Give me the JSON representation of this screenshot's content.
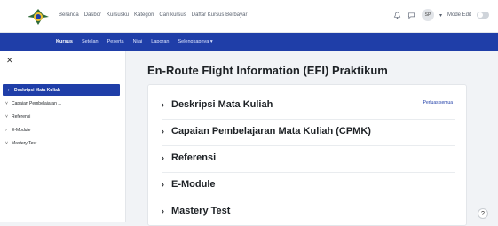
{
  "top_nav": [
    "Beranda",
    "Dasbor",
    "Kursusku",
    "Kategori",
    "Cari kursus",
    "Daftar Kursus Berbayar"
  ],
  "user": {
    "initials": "SP",
    "edit_mode_label": "Mode Edit"
  },
  "course_nav": [
    "Kursus",
    "Setelan",
    "Peserta",
    "Nilai",
    "Laporan",
    "Selengkapnya"
  ],
  "sidebar": {
    "items": [
      {
        "label": "Deskripsi Mata Kuliah",
        "chev": "›",
        "active": true
      },
      {
        "label": "Capaian Pembelajaran ...",
        "chev": "˅",
        "active": false
      },
      {
        "label": "Referensi",
        "chev": "˅",
        "active": false
      },
      {
        "label": "E-Module",
        "chev": "›",
        "active": false
      },
      {
        "label": "Mastery Test",
        "chev": "˅",
        "active": false
      }
    ]
  },
  "main": {
    "title": "En-Route Flight Information (EFI) Praktikum",
    "collapse_all": "Perluas semua",
    "sections": [
      "Deskripsi Mata Kuliah",
      "Capaian Pembelajaran Mata Kuliah (CPMK)",
      "Referensi",
      "E-Module",
      "Mastery Test"
    ]
  },
  "help_label": "?",
  "colors": {
    "brand": "#1f3ea8",
    "background": "#f1f3f6"
  }
}
